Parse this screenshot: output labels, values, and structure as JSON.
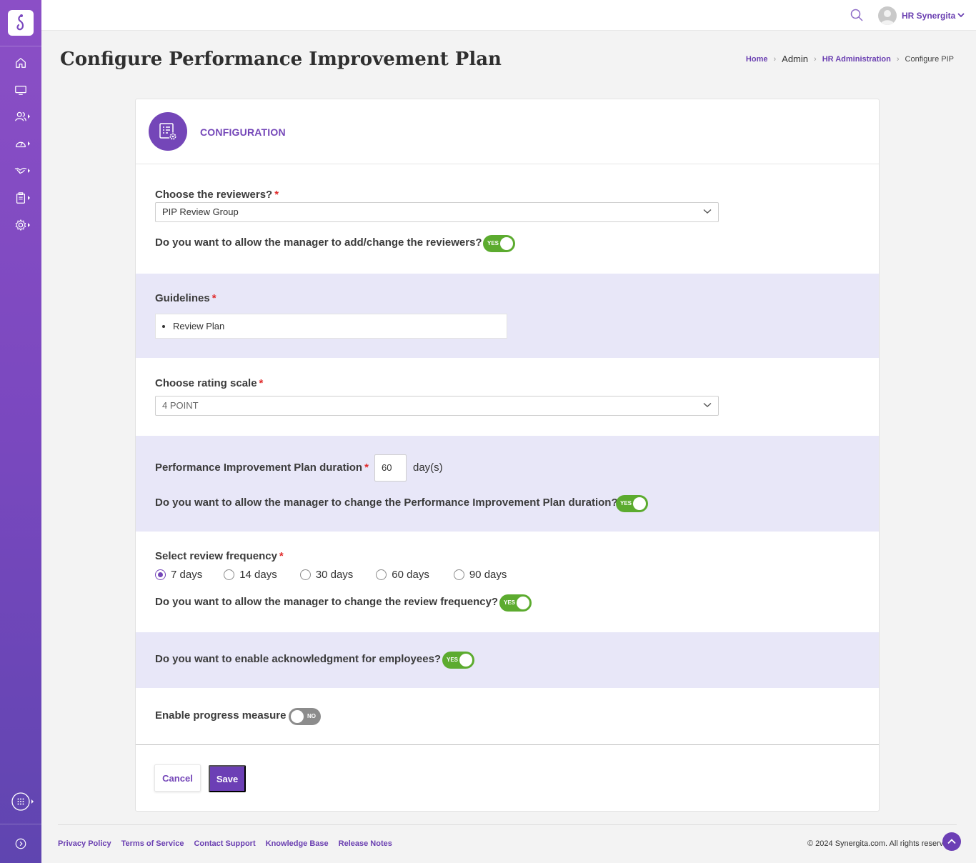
{
  "sidebar": {
    "logo": "synergita-logo",
    "items": [
      {
        "icon": "home-icon",
        "has_submenu": false
      },
      {
        "icon": "monitor-icon",
        "has_submenu": false
      },
      {
        "icon": "users-icon",
        "has_submenu": true
      },
      {
        "icon": "dashboard-gauge-icon",
        "has_submenu": true
      },
      {
        "icon": "handshake-icon",
        "has_submenu": true
      },
      {
        "icon": "clipboard-icon",
        "has_submenu": true
      },
      {
        "icon": "settings-icon",
        "has_submenu": true
      }
    ],
    "bottom": [
      {
        "icon": "apps-grid-icon"
      },
      {
        "icon": "expand-arrow-icon"
      }
    ]
  },
  "topbar": {
    "user_name": "HR Synergita"
  },
  "header": {
    "title": "Configure Performance Improvement Plan",
    "breadcrumb": {
      "home": "Home",
      "admin": "Admin",
      "hr_admin": "HR Administration",
      "current": "Configure PIP"
    }
  },
  "card": {
    "title": "CONFIGURATION",
    "reviewers": {
      "label": "Choose the reviewers?",
      "required": "*",
      "selected": "PIP Review Group",
      "allow_change_label": "Do you want to allow the manager to add/change the reviewers?",
      "allow_change_toggle": "YES"
    },
    "guidelines": {
      "label": "Guidelines",
      "required": "*",
      "items": [
        "Review Plan"
      ]
    },
    "rating_scale": {
      "label": "Choose rating scale",
      "required": "*",
      "selected": "4 POINT"
    },
    "duration": {
      "label": "Performance Improvement Plan duration",
      "required": "*",
      "value": "60",
      "unit": "day(s)",
      "allow_change_label": "Do you want to allow the manager to change the Performance Improvement Plan duration?",
      "allow_change_toggle": "YES"
    },
    "frequency": {
      "label": "Select review frequency",
      "required": "*",
      "options": [
        "7 days",
        "14 days",
        "30 days",
        "60 days",
        "90 days"
      ],
      "selected": "7 days",
      "allow_change_label": "Do you want to allow the manager to change the review frequency?",
      "allow_change_toggle": "YES"
    },
    "acknowledgment": {
      "label": "Do you want to enable acknowledgment for employees?",
      "toggle": "YES"
    },
    "progress": {
      "label": "Enable progress measure",
      "toggle": "NO"
    },
    "buttons": {
      "cancel": "Cancel",
      "save": "Save"
    }
  },
  "footer": {
    "links": [
      "Privacy Policy",
      "Terms of Service",
      "Contact Support",
      "Knowledge Base",
      "Release Notes"
    ],
    "copyright": "© 2024 Synergita.com. All rights reserved."
  },
  "colors": {
    "brand": "#7446b8",
    "toggle_on": "#5cab2f",
    "toggle_off": "#8c8c8c",
    "tint_section": "#e8e7f8",
    "required": "#e02b2b"
  }
}
